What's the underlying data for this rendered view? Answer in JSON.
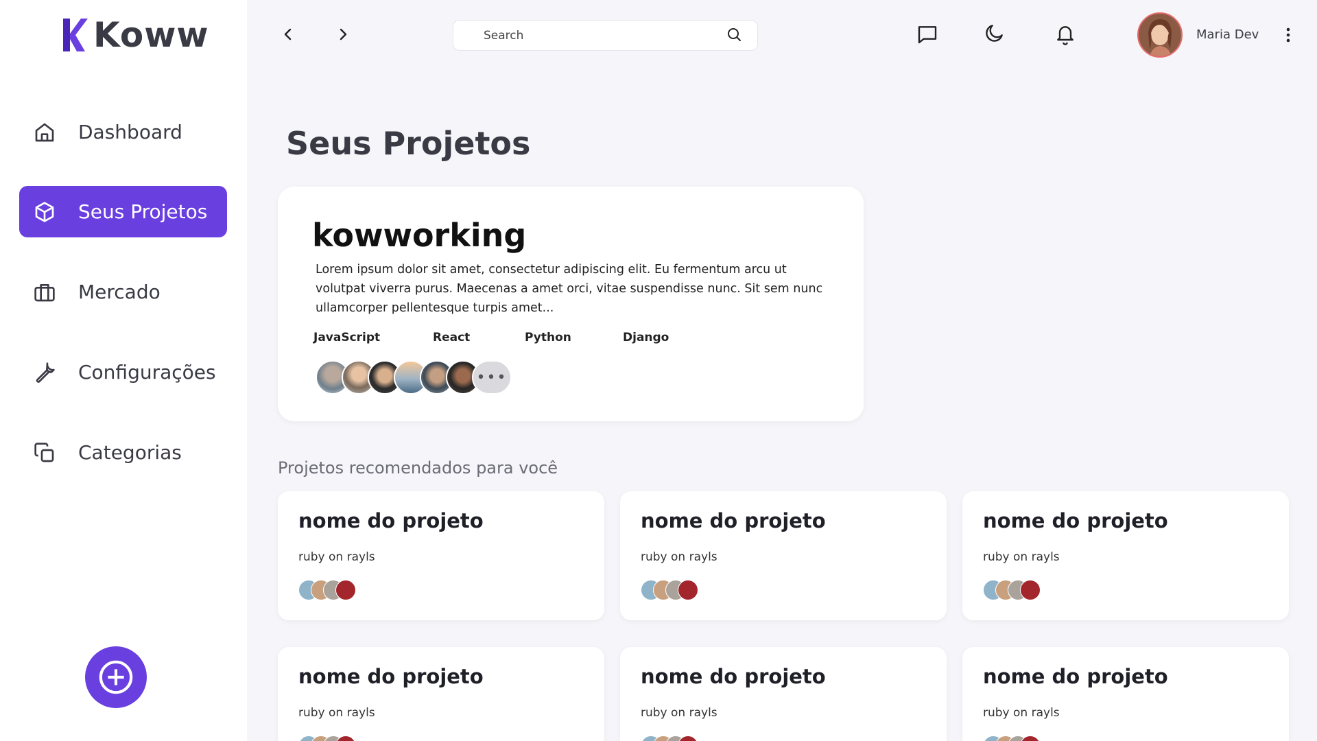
{
  "brand": {
    "name": "Koww",
    "accent": "#6A3FE0"
  },
  "sidebar": {
    "items": [
      {
        "label": "Dashboard",
        "icon": "home-icon",
        "active": false
      },
      {
        "label": "Seus Projetos",
        "icon": "box-icon",
        "active": true
      },
      {
        "label": "Mercado",
        "icon": "briefcase-icon",
        "active": false
      },
      {
        "label": "Configurações",
        "icon": "wrench-icon",
        "active": false
      },
      {
        "label": "Categorias",
        "icon": "copy-icon",
        "active": false
      }
    ],
    "fab_icon": "plus-circle-icon"
  },
  "topbar": {
    "search_placeholder": "Search",
    "user_name": "Maria Dev",
    "icons": [
      "chevron-left-icon",
      "chevron-right-icon",
      "search-icon",
      "message-icon",
      "moon-icon",
      "bell-icon",
      "more-vertical-icon"
    ]
  },
  "main": {
    "page_title": "Seus Projetos",
    "featured": {
      "title": "kowworking",
      "description": "Lorem ipsum dolor sit amet, consectetur adipiscing elit. Eu fermentum arcu ut volutpat viverra purus. Maecenas a amet orci, vitae suspendisse nunc. Sit sem nunc ullamcorper pellentesque turpis amet...",
      "tags": [
        "JavaScript",
        "React",
        "Python",
        "Django"
      ],
      "more_label": "•••"
    },
    "recommended_title": "Projetos recomendados para você",
    "cards": [
      {
        "title": "nome do projeto",
        "subtitle": "ruby on rayls"
      },
      {
        "title": "nome do projeto",
        "subtitle": "ruby on rayls"
      },
      {
        "title": "nome do projeto",
        "subtitle": "ruby on rayls"
      },
      {
        "title": "nome do projeto",
        "subtitle": "ruby on rayls"
      },
      {
        "title": "nome do projeto",
        "subtitle": "ruby on rayls"
      },
      {
        "title": "nome do projeto",
        "subtitle": "ruby on rayls"
      }
    ]
  }
}
